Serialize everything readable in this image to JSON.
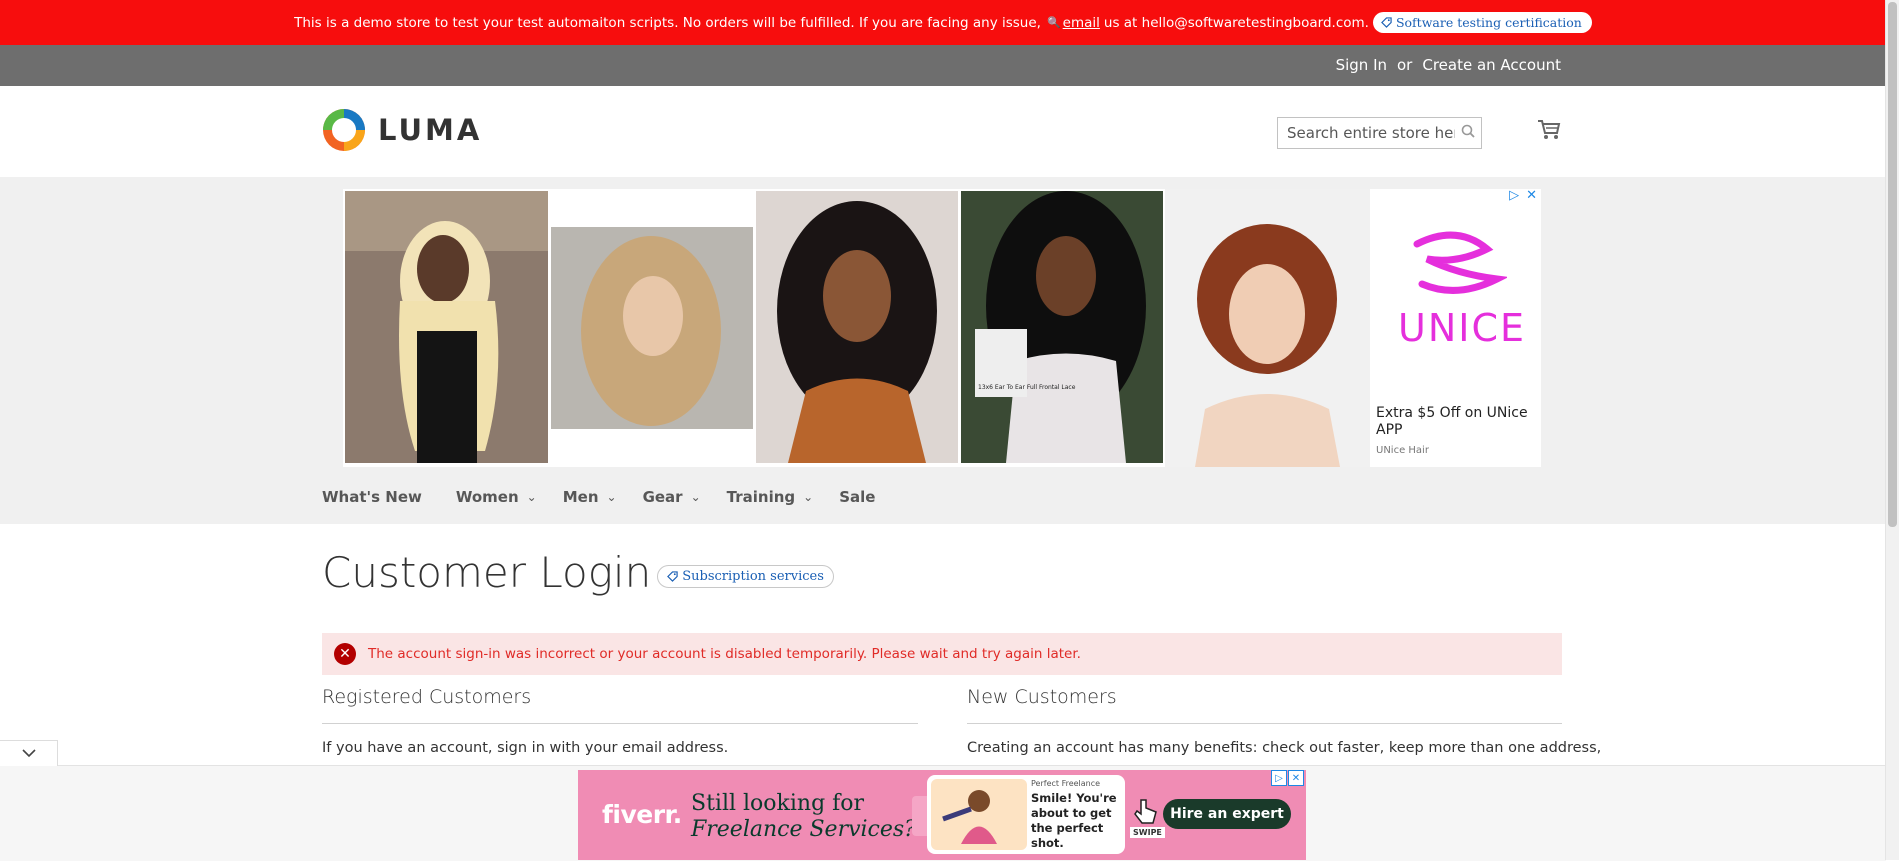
{
  "demo_banner": {
    "text": "This is a demo store to test your test automaiton scripts. No orders will be fulfilled. If you are facing any issue,",
    "email_link": "email",
    "email_text": "us at hello@softwaretestingboard.com.",
    "cert_label": "Software testing certification"
  },
  "auth": {
    "sign_in": "Sign In",
    "or": "or",
    "create_account": "Create an Account"
  },
  "header": {
    "logo_text": "LUMA",
    "search_placeholder": "Search entire store here..."
  },
  "ad_top": {
    "brand": "UNICE",
    "offer": "Extra $5 Off on UNice APP",
    "source": "UNice Hair",
    "inset_caption": "13x6 Ear To Ear Full Frontal Lace"
  },
  "nav": {
    "items": [
      {
        "label": "What's New",
        "has_dropdown": false
      },
      {
        "label": "Women",
        "has_dropdown": true
      },
      {
        "label": "Men",
        "has_dropdown": true
      },
      {
        "label": "Gear",
        "has_dropdown": true
      },
      {
        "label": "Training",
        "has_dropdown": true
      },
      {
        "label": "Sale",
        "has_dropdown": false
      }
    ]
  },
  "main": {
    "title": "Customer Login",
    "subscription_pill": "Subscription services",
    "error": "The account sign-in was incorrect or your account is disabled temporarily. Please wait and try again later.",
    "registered_title": "Registered Customers",
    "registered_text": "If you have an account, sign in with your email address.",
    "new_title": "New Customers",
    "new_text": "Creating an account has many benefits: check out faster, keep more than one address,"
  },
  "ad_bottom": {
    "logo": "fiverr.",
    "headline_1": "Still looking for",
    "headline_2": "Freelance Services?",
    "card_small": "Perfect Freelance",
    "card_text": "Smile! You're about to get the perfect shot.",
    "swipe": "SWIPE",
    "cta": "Hire an expert"
  },
  "colors": {
    "demo_bar": "#f70d0d",
    "auth_bar": "#6e6e6e",
    "error_bg": "#fae5e5",
    "error_text": "#e02b27",
    "link_blue": "#1a5fb4"
  }
}
